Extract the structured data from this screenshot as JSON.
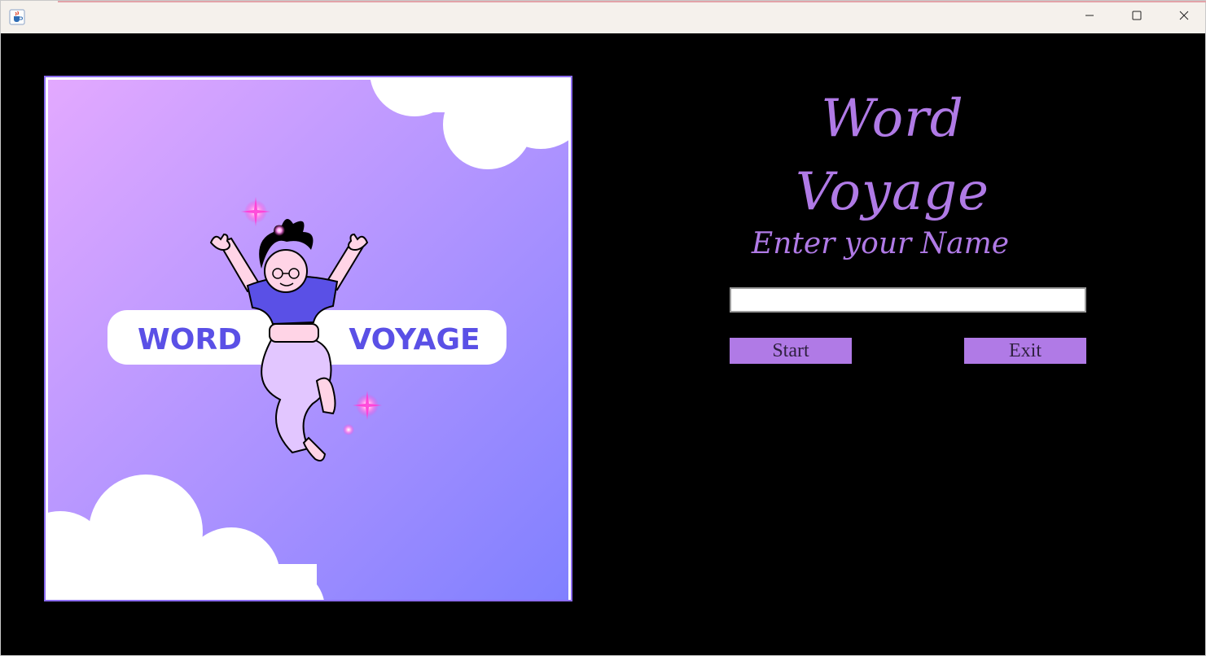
{
  "window": {
    "icons": {
      "app": "java-cup-icon",
      "minimize": "minimize-icon",
      "maximize": "maximize-icon",
      "close": "close-icon"
    }
  },
  "art": {
    "word_left": "WORD",
    "word_right": "VOYAGE",
    "colors": {
      "gradient_start": "#e3a9ff",
      "gradient_end": "#8080ff",
      "pill_text": "#5a50e6",
      "sparkle": "#ff3dd6"
    }
  },
  "main": {
    "title": "Word Voyage",
    "name_label": "Enter your Name",
    "name_value": "",
    "start_label": "Start",
    "exit_label": "Exit",
    "accent_color": "#b07ae6"
  }
}
